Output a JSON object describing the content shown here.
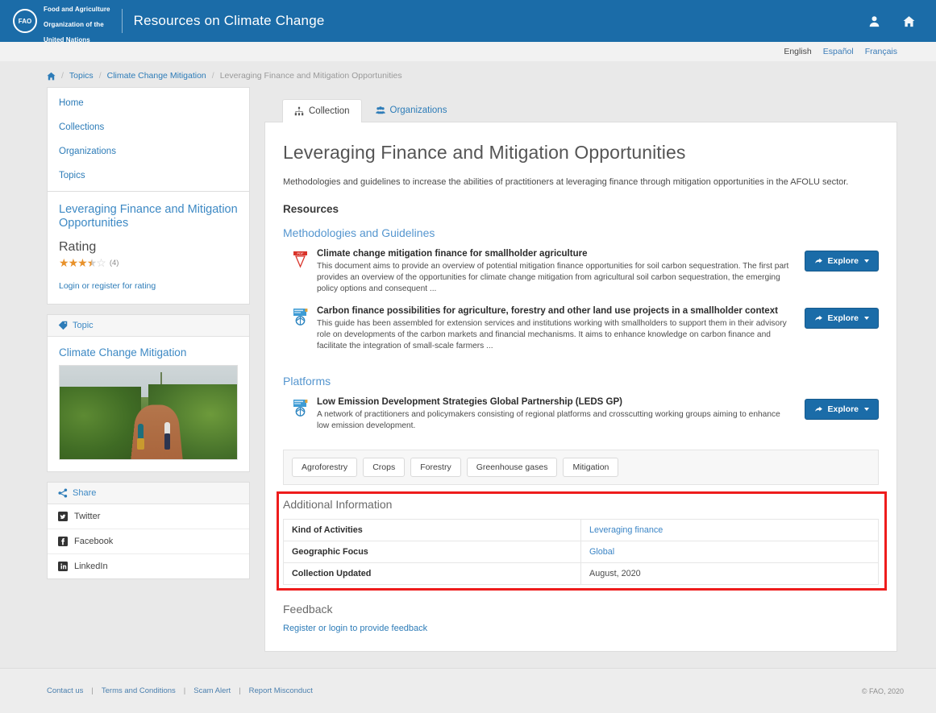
{
  "header": {
    "org_line1": "Food and Agriculture",
    "org_line2": "Organization of the",
    "org_line3": "United Nations",
    "seal_text": "FAO",
    "site_title": "Resources on Climate Change",
    "user_icon": "user-icon",
    "home_icon": "home-icon",
    "brand_color": "#1b6ca8"
  },
  "languages": [
    {
      "label": "English",
      "active": true
    },
    {
      "label": "Español",
      "active": false
    },
    {
      "label": "Français",
      "active": false
    }
  ],
  "breadcrumb": {
    "home_icon": "home-icon",
    "items": [
      "Topics",
      "Climate Change Mitigation",
      "Leveraging Finance and Mitigation Opportunities"
    ]
  },
  "sidebar": {
    "nav": [
      {
        "label": "Home"
      },
      {
        "label": "Collections"
      },
      {
        "label": "Organizations"
      },
      {
        "label": "Topics"
      }
    ],
    "collection_title": "Leveraging Finance and Mitigation Opportunities",
    "rating_heading": "Rating",
    "rating_value": 3.5,
    "rating_count": "(4)",
    "login_rating": "Login or register for rating",
    "topic_header": "Topic",
    "topic_header_icon": "tag-icon",
    "topic_name": "Climate Change Mitigation",
    "share_header": "Share",
    "share_header_icon": "share-icon",
    "share_items": [
      {
        "label": "Twitter",
        "icon": "twitter-icon"
      },
      {
        "label": "Facebook",
        "icon": "facebook-icon"
      },
      {
        "label": "LinkedIn",
        "icon": "linkedin-icon"
      }
    ]
  },
  "main": {
    "tabs": [
      {
        "label": "Collection",
        "icon": "sitemap-icon",
        "active": true
      },
      {
        "label": "Organizations",
        "icon": "users-icon",
        "active": false
      }
    ],
    "collection_title": "Leveraging Finance and Mitigation Opportunities",
    "collection_description": "Methodologies and guidelines to increase the abilities of practitioners at leveraging finance through mitigation opportunities in the AFOLU sector.",
    "resources_heading": "Resources",
    "groups": [
      {
        "heading": "Methodologies and Guidelines",
        "items": [
          {
            "icon": "pdf-file-icon",
            "title": "Climate change mitigation finance for smallholder agriculture",
            "description": "This document aims to provide an overview of potential mitigation finance opportunities for soil carbon sequestration. The first part provides an overview of the opportunities for climate change mitigation from agricultural soil carbon sequestration, the emerging policy options and consequent ...",
            "button_label": "Explore",
            "button_icon": "share-arrow-icon"
          },
          {
            "icon": "web-link-icon",
            "title": "Carbon finance possibilities for agriculture, forestry and other land use projects in a smallholder context",
            "description": "This guide has been assembled for extension services and institutions working with smallholders to support them in their advisory role on developments of the carbon markets and financial mechanisms. It aims to enhance knowledge on carbon finance and facilitate the integration of small-scale farmers ...",
            "button_label": "Explore",
            "button_icon": "share-arrow-icon"
          }
        ]
      },
      {
        "heading": "Platforms",
        "items": [
          {
            "icon": "web-link-icon",
            "title": "Low Emission Development Strategies Global Partnership (LEDS GP)",
            "description": "A network of practitioners and policymakers consisting of regional platforms and crosscutting working groups aiming to enhance low emission development.",
            "button_label": "Explore",
            "button_icon": "share-arrow-icon"
          }
        ]
      }
    ],
    "tags": [
      "Agroforestry",
      "Crops",
      "Forestry",
      "Greenhouse gases",
      "Mitigation"
    ],
    "additional_information": {
      "heading": "Additional Information",
      "highlight_color": "#ee1c1c",
      "rows": [
        {
          "key": "Kind of Activities",
          "value": "Leveraging finance",
          "is_link": true
        },
        {
          "key": "Geographic Focus",
          "value": "Global",
          "is_link": true
        },
        {
          "key": "Collection Updated",
          "value": "August, 2020",
          "is_link": false
        }
      ]
    },
    "feedback": {
      "heading": "Feedback",
      "link": "Register or login to provide feedback"
    }
  },
  "footer": {
    "links": [
      "Contact us",
      "Terms and Conditions",
      "Scam Alert",
      "Report Misconduct"
    ],
    "copyright": "© FAO, 2020"
  }
}
